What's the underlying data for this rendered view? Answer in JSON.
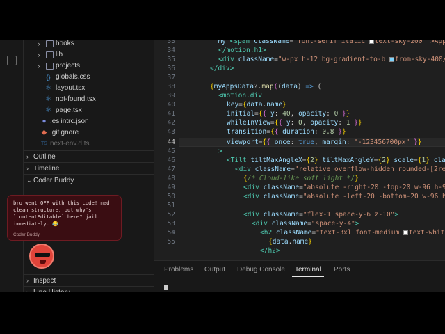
{
  "explorer": {
    "items": [
      {
        "label": "hooks",
        "kind": "folder"
      },
      {
        "label": "lib",
        "kind": "folder"
      },
      {
        "label": "projects",
        "kind": "folder"
      },
      {
        "label": "globals.css",
        "kind": "css"
      },
      {
        "label": "layout.tsx",
        "kind": "tsx"
      },
      {
        "label": "not-found.tsx",
        "kind": "tsx"
      },
      {
        "label": "page.tsx",
        "kind": "tsx"
      },
      {
        "label": ".eslintrc.json",
        "kind": "json"
      },
      {
        "label": ".gitignore",
        "kind": "git"
      },
      {
        "label": "next-env.d.ts",
        "kind": "ts"
      }
    ]
  },
  "panels": {
    "outline": "Outline",
    "timeline": "Timeline",
    "coder_buddy": "Coder Buddy",
    "inspect": "Inspect",
    "line_history": "Line History"
  },
  "buddy": {
    "message": "bro went OFF with this code! mad\nclean structure, but why's\n`contentEditable` here? jail.\nimmediately. 😂",
    "author": "Coder Buddy"
  },
  "editor": {
    "line_numbers": [
      "33",
      "34",
      "35",
      "36",
      "37",
      "38",
      "39",
      "40",
      "41",
      "42",
      "43",
      "44",
      "45",
      "46",
      "47",
      "48",
      "49",
      "50",
      "51",
      "52",
      "53",
      "54",
      "55"
    ],
    "active_line": "44"
  },
  "bottom_tabs": [
    "Problems",
    "Output",
    "Debug Console",
    "Terminal",
    "Ports"
  ],
  "active_bottom_tab": "Terminal",
  "colors": {
    "accent_blue": "#4d9de0",
    "buddy_bg": "#3a0d12",
    "swatch_sky": "#7dd3fc",
    "swatch_white": "#ffffff"
  }
}
